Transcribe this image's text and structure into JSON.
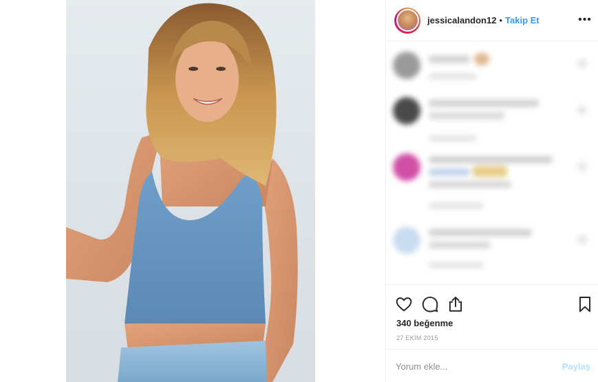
{
  "post": {
    "username": "jessicalandon12",
    "separator": "•",
    "follow_label": "Takip Et",
    "more_icon": "more-horizontal-icon",
    "more_label": "•••",
    "likes_text": "340 beğenme",
    "date_text": "27 EKİM 2015"
  },
  "comment_box": {
    "placeholder": "Yorum ekle...",
    "post_label": "Paylaş"
  },
  "actions": {
    "icons": [
      "heart-icon",
      "comment-icon",
      "share-icon",
      "bookmark-icon"
    ]
  },
  "colors": {
    "accent": "#3897f0",
    "post_disabled": "#b2dffc",
    "muted": "#999999",
    "border": "#efefef"
  }
}
